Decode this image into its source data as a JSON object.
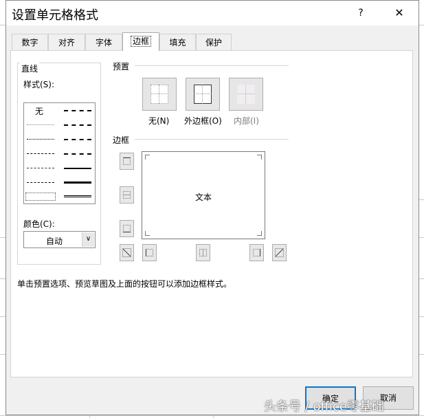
{
  "dialog": {
    "title": "设置单元格格式",
    "help_label": "?",
    "close_label": "✕"
  },
  "tabs": [
    {
      "label": "数字"
    },
    {
      "label": "对齐"
    },
    {
      "label": "字体"
    },
    {
      "label": "边框",
      "active": true
    },
    {
      "label": "填充"
    },
    {
      "label": "保护"
    }
  ],
  "line_group": {
    "title": "直线",
    "style_label": "样式(S):",
    "none_label": "无",
    "color_label": "颜色(C):",
    "color_value": "自动"
  },
  "presets": {
    "title": "预置",
    "items": [
      {
        "label": "无(N)"
      },
      {
        "label": "外边框(O)"
      },
      {
        "label": "内部(I)",
        "disabled": true
      }
    ]
  },
  "border": {
    "title": "边框",
    "preview_text": "文本"
  },
  "hint": "单击预置选项、预览草图及上面的按钮可以添加边框样式。",
  "footer": {
    "ok_label": "确定",
    "cancel_label": "取消"
  },
  "watermark": "头条号 / office零基础",
  "colors": {
    "accent": "#0078d7",
    "dialog_bg": "#f0f0f0",
    "panel_bg": "#ffffff"
  }
}
